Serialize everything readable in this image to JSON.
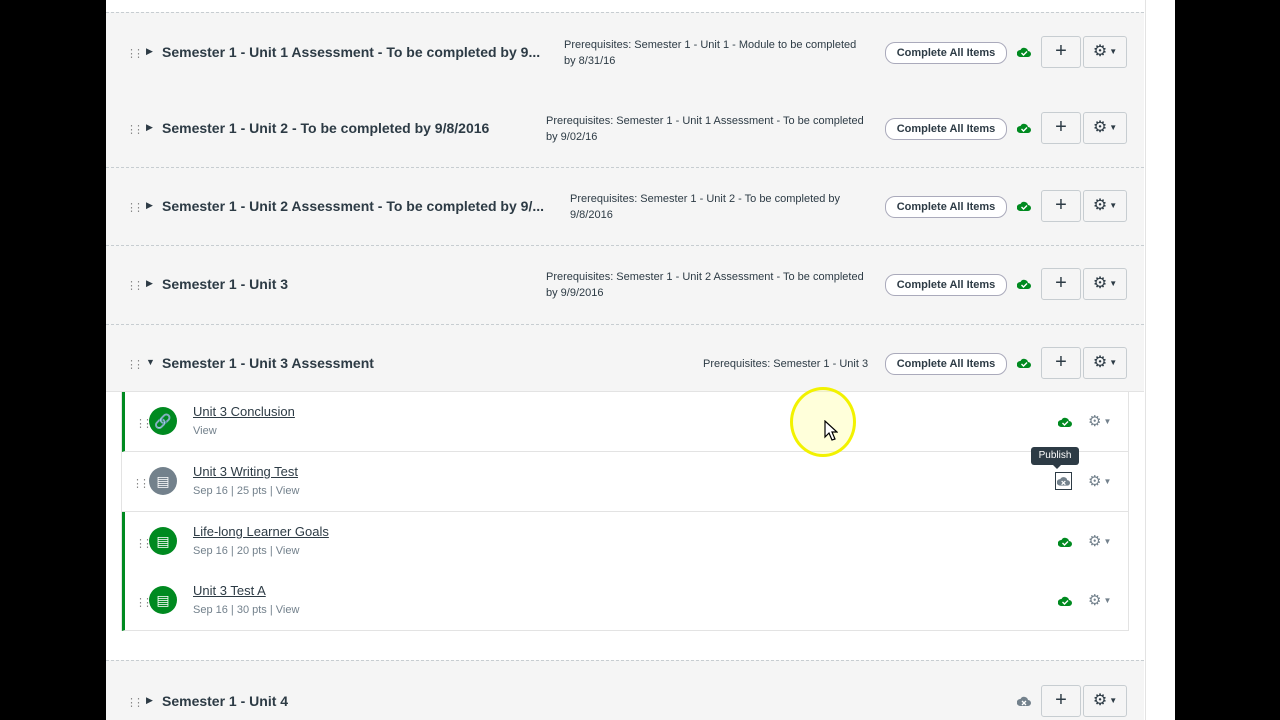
{
  "modules": [
    {
      "title": "Semester 1 - Unit 1 Assessment - To be completed by 9...",
      "prereq_lines": [
        "Prerequisites: Semester 1 - Unit 1 - Module to be completed",
        "by 8/31/16"
      ],
      "complete_label": "Complete All Items",
      "published": true,
      "expanded": false
    },
    {
      "title": "Semester 1 - Unit 2 - To be completed by 9/8/2016",
      "prereq_lines": [
        "Prerequisites: Semester 1 - Unit 1 Assessment - To be completed",
        "by 9/02/16"
      ],
      "complete_label": "Complete All Items",
      "published": true,
      "expanded": false
    },
    {
      "title": "Semester 1 - Unit 2 Assessment - To be completed by 9/...",
      "prereq_lines": [
        "Prerequisites: Semester 1 - Unit 2 - To be completed by",
        "9/8/2016"
      ],
      "complete_label": "Complete All Items",
      "published": true,
      "expanded": false
    },
    {
      "title": "Semester 1 - Unit 3",
      "prereq_lines": [
        "Prerequisites: Semester 1 - Unit 2 Assessment - To be completed",
        "by 9/9/2016"
      ],
      "complete_label": "Complete All Items",
      "published": true,
      "expanded": false
    },
    {
      "title": "Semester 1 - Unit 3 Assessment",
      "prereq_lines": [
        "Prerequisites: Semester 1 - Unit 3"
      ],
      "complete_label": "Complete All Items",
      "published": true,
      "expanded": true
    },
    {
      "title": "Semester 1 - Unit 4",
      "prereq_lines": [],
      "complete_label": "",
      "published": false,
      "expanded": false
    }
  ],
  "items": [
    {
      "title": "Unit 3 Conclusion",
      "meta": "View",
      "icon": "link-icon",
      "published": true
    },
    {
      "title": "Unit 3 Writing Test",
      "meta": "Sep 16  |  25 pts  |  View",
      "icon": "assignment-icon",
      "published": false
    },
    {
      "title": "Life-long Learner Goals",
      "meta": "Sep 16  |  20 pts  |  View",
      "icon": "assignment-icon",
      "published": true
    },
    {
      "title": "Unit 3 Test A",
      "meta": "Sep 16  |  30 pts  |  View",
      "icon": "assignment-icon",
      "published": true
    }
  ],
  "tooltip": "Publish",
  "colors": {
    "published_green": "#008a20",
    "unpublished_gray": "#73818c"
  }
}
